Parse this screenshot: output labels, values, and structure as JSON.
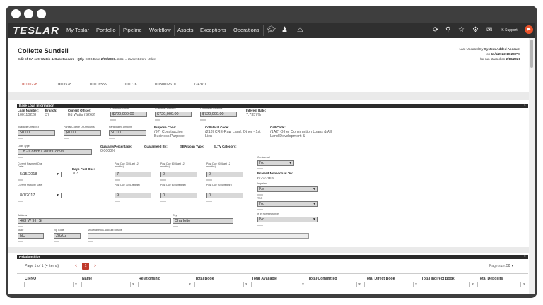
{
  "nav": {
    "logo": "TESLAR",
    "items": [
      "My Teslar",
      "Portfolio",
      "Pipeline",
      "Workflow",
      "Assets",
      "Exceptions",
      "Operations"
    ],
    "support": "IK Support"
  },
  "header": {
    "name": "Collette Sundell",
    "subtitle_prefix": "Edit of CA set: Watch & Substandard - Qtly.",
    "cob_label": "COB Date",
    "cob_date": "2/15/2021.",
    "ccv_note": "CCV = Current Core Value",
    "last_updated_label": "Last Updated By",
    "last_updated_by": "System Added Account",
    "updated_on_label": "on",
    "updated_on": "11/1/2022 10:28 PM",
    "run_label": "for run started on",
    "run_date": "2/18/2021"
  },
  "tabs": [
    "100110228",
    "10011578",
    "100116555",
    "1001776",
    "10050012610",
    "724370"
  ],
  "base": {
    "title": "Base Loan Information",
    "loan_number_label": "Loan Number:",
    "loan_number": "100110228",
    "branch_label": "Branch:",
    "branch": "37",
    "officer_label": "Current Officer:",
    "officer": "Ed Watts (S263)",
    "cur_bal_label": "Current Balance",
    "cur_bal": "$720,000.00",
    "ccv_bal_label": "Customer Balance",
    "ccv_bal": "$720,000.00",
    "comm_bal_label": "Committed Balance",
    "comm_bal": "$720,000.00",
    "rate_label": "Interest Rate:",
    "rate": "7.7357%",
    "avail_label": "Available Credit/Ct",
    "avail": "$0.00",
    "chargeoff_label": "Partial Charge Off Amounts",
    "chargeoff": "$0.00",
    "participated_label": "Participated Amount",
    "participated": "$0.00",
    "purpose_label": "Purpose Code:",
    "purpose": "(97) Construction Business Purpose",
    "collateral_label": "Collateral Code:",
    "collateral": "(213) CRE-Raw Land: Other - 1st Lien",
    "callcode_label": "Call Code:",
    "callcode": "(1A2) Other Construction Loans & All Land Development &",
    "loantype_label": "Loan Type",
    "loantype": "1.8 - Comm Const Conv.s",
    "guar_pct_label": "GuarantyPercentage:",
    "guar_pct": "0.0000%",
    "guar_by_label": "Guaranteed By:",
    "sba_label": "SBA Loan Type:",
    "sltv_label": "SLTV Category:",
    "pay_due_label": "Current Payment Due Date:",
    "pay_due": "5/15/2018",
    "days_past_label": "Days Past Due:",
    "days_past": "703",
    "pd30_label": "Past Due 30 (Last 12 months)",
    "pd30": "7",
    "pd60_label": "Past Due 60 (Last 12 months)",
    "pd60": "0",
    "pd90_label": "Past Due 90 (Last 12 months)",
    "pd90": "0",
    "maturity_label": "Current Maturity Date:",
    "maturity": "8/1/2017",
    "pd30b_label": "Past Due 30 (Lifetime)",
    "pd30b": "9",
    "pd60b_label": "Past Due 60 (Lifetime)",
    "pd60b": "0",
    "pd90b_label": "Past Due 90 (Lifetime)",
    "pd90b": "0",
    "accrual_label": "On Accrual",
    "accrual": "No",
    "nonaccrual_label": "Entered Nonaccrual On:",
    "nonaccrual": "6/29/2009",
    "impaired_label": "Impaired",
    "impaired": "No",
    "tdr_label": "TDR",
    "tdr": "No",
    "forb_label": "Is in Forebearance",
    "forb": "No",
    "address_label": "Address",
    "address": "463 W 9th St",
    "city_label": "City",
    "city": "Charlotte",
    "state_label": "State",
    "state": "NC",
    "zip_label": "Zip Code",
    "zip": "28202",
    "misc_label": "Miscellaneous Account Details"
  },
  "rel": {
    "title": "Relationships",
    "page_text": "Page 1 of 1 (4 items)",
    "page_prev": "<",
    "page_current": "1",
    "page_next": ">",
    "page_size_label": "Page size:",
    "page_size": "50",
    "columns": [
      "CIFNO",
      "Name",
      "Relationship",
      "Total Book",
      "Total Available",
      "Total Committed",
      "Total Direct Book",
      "Total Indirect Book",
      "Total Deposits"
    ]
  }
}
